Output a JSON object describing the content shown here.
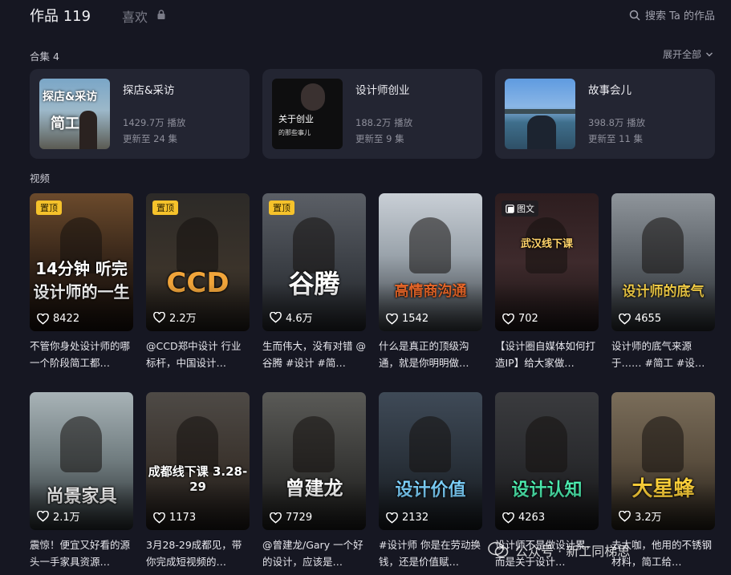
{
  "header": {
    "works_label": "作品 119",
    "likes_label": "喜欢",
    "search_placeholder": "搜索 Ta 的作品"
  },
  "collections_section": {
    "label": "合集 4",
    "expand_label": "展开全部",
    "items": [
      {
        "title": "探店&采访",
        "plays": "1429.7万 播放",
        "update": "更新至 24 集",
        "cover_text_1": "探店&采访",
        "cover_text_2": "简工"
      },
      {
        "title": "设计师创业",
        "plays": "188.2万 播放",
        "update": "更新至 9 集",
        "cover_text_1": "关于创业",
        "cover_text_2": "的那些事儿"
      },
      {
        "title": "故事会儿",
        "plays": "398.8万 播放",
        "update": "更新至 11 集"
      }
    ]
  },
  "videos_section": {
    "label": "视频",
    "pinned_label": "置顶",
    "imgtext_label": "图文",
    "items": [
      {
        "overlay": "14分钟 听完设计师的一生",
        "likes": "8422",
        "desc": "不管你身处设计师的哪一个阶段简工都…"
      },
      {
        "overlay": "CCD",
        "likes": "2.2万",
        "desc": "@CCD郑中设计 行业标杆，中国设计…"
      },
      {
        "overlay": "谷腾",
        "likes": "4.6万",
        "desc": "生而伟大，没有对错 @谷腾 #设计 #简…"
      },
      {
        "overlay": "高情商沟通",
        "likes": "1542",
        "desc": "什么是真正的顶级沟通，就是你明明做…"
      },
      {
        "overlay": "武汉线下课",
        "likes": "702",
        "desc": "【设计圈自媒体如何打造IP】给大家做…"
      },
      {
        "overlay": "设计师的底气",
        "likes": "4655",
        "desc": "设计师的底气来源于…… #简工 #设…"
      },
      {
        "overlay": "尚景家具",
        "likes": "2.1万",
        "desc": "震惊！便宜又好看的源头一手家具资源…"
      },
      {
        "overlay": "成都线下课 3.28-29",
        "likes": "1173",
        "desc": "3月28-29成都见，带你完成短视频的…"
      },
      {
        "overlay": "曾建龙",
        "likes": "7729",
        "desc": "@曾建龙/Gary 一个好的设计，应该是…"
      },
      {
        "overlay": "设计价值",
        "likes": "2132",
        "desc": "#设计师 你是在劳动换钱，还是价值赋…"
      },
      {
        "overlay": "设计认知",
        "likes": "4263",
        "desc": "设计师不是做设计累，而是关于设计…"
      },
      {
        "overlay": "大星蜂",
        "likes": "3.2万",
        "desc": "去太咖，他用的不锈钢材料，简工给…"
      }
    ]
  },
  "watermark": {
    "text": "公众号 · 新工同梯思"
  },
  "colors": {
    "accent_pin": "#f5c22b",
    "background": "#161722",
    "card": "#232532"
  }
}
